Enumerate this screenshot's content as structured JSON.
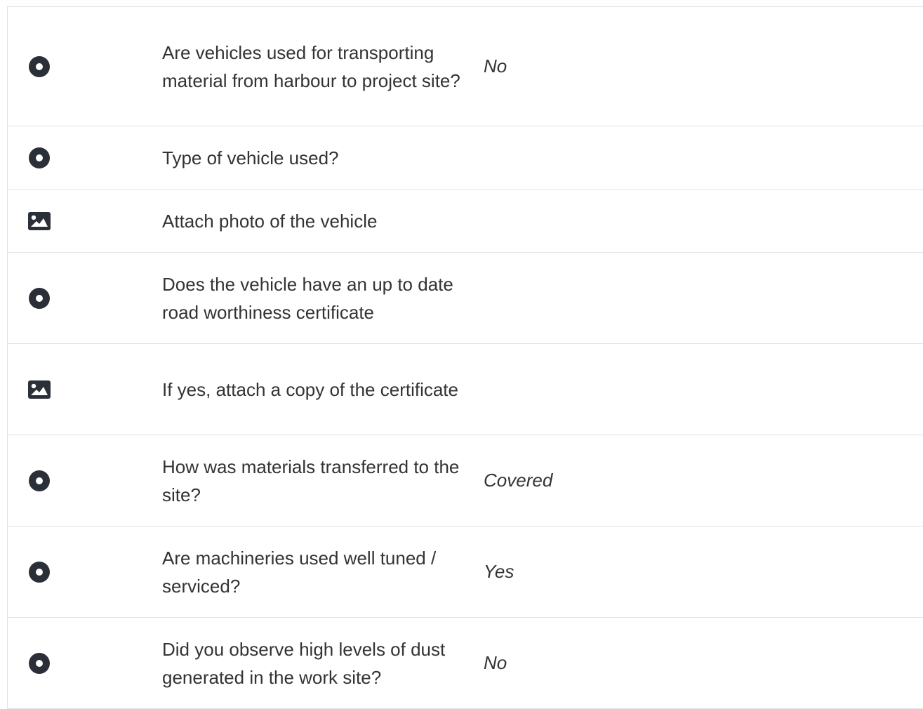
{
  "rows": [
    {
      "icon": "radio-icon",
      "question": "Are vehicles used for transporting material from harbour to project site?",
      "answer": "No"
    },
    {
      "icon": "radio-icon",
      "question": "Type of vehicle used?",
      "answer": ""
    },
    {
      "icon": "image-icon",
      "question": "Attach photo of the vehicle",
      "answer": ""
    },
    {
      "icon": "radio-icon",
      "question": "Does the vehicle have an up to date road worthiness certificate",
      "answer": ""
    },
    {
      "icon": "image-icon",
      "question": "If yes, attach a copy of the certificate",
      "answer": ""
    },
    {
      "icon": "radio-icon",
      "question": "How was materials transferred to the site?",
      "answer": "Covered"
    },
    {
      "icon": "radio-icon",
      "question": "Are machineries used well tuned / serviced?",
      "answer": "Yes"
    },
    {
      "icon": "radio-icon",
      "question": "Did you observe high levels of dust generated in the work site?",
      "answer": "No"
    }
  ],
  "colors": {
    "icon": "#2b2f38",
    "border": "#e2e2e2",
    "text": "#333333"
  }
}
